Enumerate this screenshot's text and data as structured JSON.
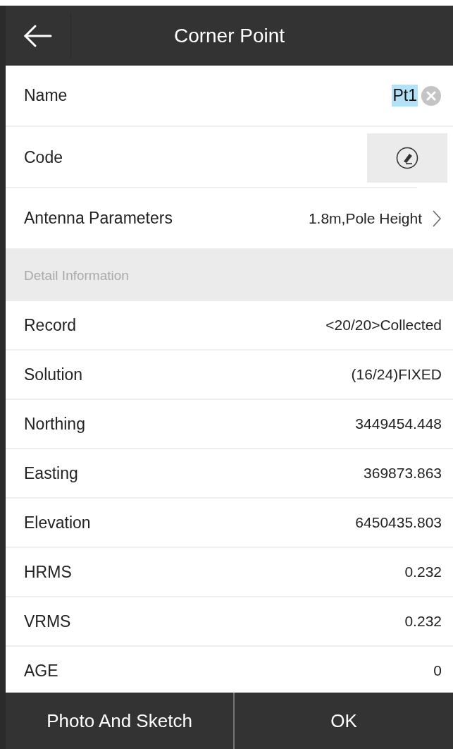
{
  "header": {
    "title": "Corner Point"
  },
  "form": {
    "name": {
      "label": "Name",
      "value": "Pt1",
      "selected": true
    },
    "code": {
      "label": "Code"
    },
    "antenna": {
      "label": "Antenna Parameters",
      "value": "1.8m,Pole Height"
    }
  },
  "section": {
    "title": "Detail Information"
  },
  "details": [
    {
      "label": "Record",
      "value": "<20/20>Collected"
    },
    {
      "label": "Solution",
      "value": "(16/24)FIXED"
    },
    {
      "label": "Northing",
      "value": "3449454.448"
    },
    {
      "label": "Easting",
      "value": "369873.863"
    },
    {
      "label": "Elevation",
      "value": "6450435.803"
    },
    {
      "label": "HRMS",
      "value": "0.232"
    },
    {
      "label": "VRMS",
      "value": "0.232"
    },
    {
      "label": "AGE",
      "value": "0"
    }
  ],
  "footer": {
    "buttons": [
      "Photo And Sketch",
      "OK"
    ]
  }
}
